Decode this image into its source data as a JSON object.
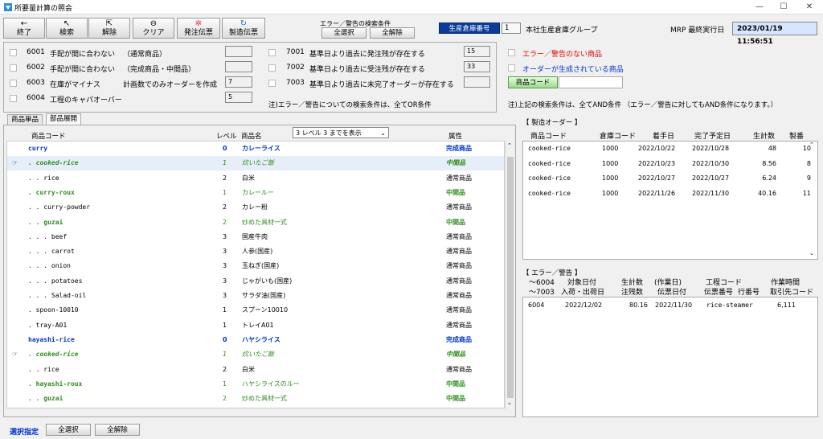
{
  "window": {
    "title": "所要量計算の照会",
    "minimize": "—",
    "maximize": "☐",
    "close": "✕"
  },
  "toolbar": {
    "buttons": [
      {
        "label": "終了",
        "icon": "←"
      },
      {
        "label": "検索",
        "icon": "↖"
      },
      {
        "label": "解除",
        "icon": "⇱"
      },
      {
        "label": "クリア",
        "icon": "⊖"
      },
      {
        "label": "発注伝票",
        "icon": "✲"
      },
      {
        "label": "製造伝票",
        "icon": "↻"
      }
    ]
  },
  "error_filter": {
    "title": "エラー／警告の検索条件",
    "select_all": "全選択",
    "deselect_all": "全解除"
  },
  "warehouse": {
    "label": "生産倉庫番号",
    "number": "1",
    "name": "本社生産倉庫グループ"
  },
  "mrp": {
    "label": "MRP 最終実行日",
    "datetime": "2023/01/19 11:56:51"
  },
  "conditions_left": [
    {
      "code": "6001",
      "text": "手配が間に合わない",
      "note": "（通常商品）",
      "value": ""
    },
    {
      "code": "6002",
      "text": "手配が間に合わない",
      "note": "（完成商品・中間品）",
      "value": ""
    },
    {
      "code": "6003",
      "text": "在庫がマイナス",
      "note": "計画数でのみオーダーを作成",
      "value": "7"
    },
    {
      "code": "6004",
      "text": "工程のキャパオーバー",
      "note": "",
      "value": "5"
    }
  ],
  "conditions_mid": [
    {
      "code": "7001",
      "text": "基準日より過去に発注残が存在する",
      "value": "15"
    },
    {
      "code": "7002",
      "text": "基準日より過去に受注残が存在する",
      "value": "33"
    },
    {
      "code": "7003",
      "text": "基準日より過去に未完了オーダーが存在する",
      "value": ""
    }
  ],
  "conditions_note": "注)エラー／警告についての検索条件は、全てOR条件",
  "conditions_right": {
    "no_error": "エラー／警告のない商品",
    "order_generated": "オーダーが生成されている商品",
    "product_code_label": "商品コード",
    "product_code_value": ""
  },
  "right_note": "注)上記の検索条件は、全てAND条件 （エラー／警告に対してもAND条件になります。）",
  "tabs": [
    {
      "label": "商品単品"
    },
    {
      "label": "部品展開"
    }
  ],
  "tree": {
    "headers": {
      "code": "商品コード",
      "level": "レベル",
      "name": "商品名",
      "attr": "属性"
    },
    "level_select": "3 レベル 3 までを表示",
    "rows": [
      {
        "code": "curry",
        "level": "0",
        "name": "カレーライス",
        "attr": "完成商品",
        "style": "blue",
        "indent": 0,
        "mark": ""
      },
      {
        "code": ". cooked-rice",
        "level": "1",
        "name": "炊いたご飯",
        "attr": "中間品",
        "style": "greenital",
        "indent": 1,
        "mark": "☞"
      },
      {
        "code": ". . rice",
        "level": "2",
        "name": "白米",
        "attr": "通常商品",
        "style": "plain",
        "indent": 2,
        "mark": ""
      },
      {
        "code": ". curry-roux",
        "level": "1",
        "name": "カレールー",
        "attr": "中間品",
        "style": "green",
        "indent": 1,
        "mark": ""
      },
      {
        "code": ". . curry-powder",
        "level": "2",
        "name": "カレー粉",
        "attr": "通常商品",
        "style": "plain",
        "indent": 2,
        "mark": ""
      },
      {
        "code": ". . guzai",
        "level": "2",
        "name": "炒めた具材一式",
        "attr": "中間品",
        "style": "green",
        "indent": 2,
        "mark": ""
      },
      {
        "code": ". . . beef",
        "level": "3",
        "name": "国産牛肉",
        "attr": "通常商品",
        "style": "plain",
        "indent": 3,
        "mark": ""
      },
      {
        "code": ". . . carrot",
        "level": "3",
        "name": "人参(国産)",
        "attr": "通常商品",
        "style": "plain",
        "indent": 3,
        "mark": ""
      },
      {
        "code": ". . . onion",
        "level": "3",
        "name": "玉ねぎ(国産)",
        "attr": "通常商品",
        "style": "plain",
        "indent": 3,
        "mark": ""
      },
      {
        "code": ". . . potatoes",
        "level": "3",
        "name": "じゃがいも(国産)",
        "attr": "通常商品",
        "style": "plain",
        "indent": 3,
        "mark": ""
      },
      {
        "code": ". . . Salad-oil",
        "level": "3",
        "name": "サラダ油(国産)",
        "attr": "通常商品",
        "style": "plain",
        "indent": 3,
        "mark": ""
      },
      {
        "code": ". spoon-10010",
        "level": "1",
        "name": "スプーン10010",
        "attr": "通常商品",
        "style": "plain",
        "indent": 1,
        "mark": ""
      },
      {
        "code": ". tray-A01",
        "level": "1",
        "name": "トレイA01",
        "attr": "通常商品",
        "style": "plain",
        "indent": 1,
        "mark": ""
      },
      {
        "code": "hayashi-rice",
        "level": "0",
        "name": "ハヤシライス",
        "attr": "完成商品",
        "style": "blue",
        "indent": 0,
        "mark": ""
      },
      {
        "code": ". cooked-rice",
        "level": "1",
        "name": "炊いたご飯",
        "attr": "中間品",
        "style": "greenital",
        "indent": 1,
        "mark": "☞"
      },
      {
        "code": ". . rice",
        "level": "2",
        "name": "白米",
        "attr": "通常商品",
        "style": "plain",
        "indent": 2,
        "mark": ""
      },
      {
        "code": ". hayashi-roux",
        "level": "1",
        "name": "ハヤシライスのルー",
        "attr": "中間品",
        "style": "green",
        "indent": 1,
        "mark": ""
      },
      {
        "code": ". . guzai",
        "level": "2",
        "name": "炒めた具材一式",
        "attr": "中間品",
        "style": "green",
        "indent": 2,
        "mark": ""
      }
    ]
  },
  "mfg_orders": {
    "title": "【 製造オーダー 】",
    "headers": [
      "商品コード",
      "倉庫コード",
      "着手日",
      "完了予定日",
      "生計数",
      "製番"
    ],
    "rows": [
      [
        "cooked-rice",
        "1000",
        "2022/10/22",
        "2022/10/28",
        "48",
        "10"
      ],
      [
        "cooked-rice",
        "1000",
        "2022/10/23",
        "2022/10/30",
        "8.56",
        "8"
      ],
      [
        "cooked-rice",
        "1000",
        "2022/10/27",
        "2022/10/27",
        "6.24",
        "9"
      ],
      [
        "cooked-rice",
        "1000",
        "2022/11/26",
        "2022/11/30",
        "40.16",
        "11"
      ]
    ]
  },
  "errors": {
    "title": "【 エラー／警告 】",
    "h1": [
      "～6004",
      "対象日付",
      "生計数",
      "(作業日)",
      "工程コード",
      "作業時間"
    ],
    "h2": [
      "～7003",
      "入荷・出荷日",
      "注残数",
      "伝票日付",
      "伝票番号",
      "行番号",
      "取引先コード"
    ],
    "rows": [
      [
        "6004",
        "2022/12/02",
        "80.16",
        "2022/11/30",
        "rice-steamer",
        "6,111"
      ]
    ]
  },
  "footer": {
    "label": "選択指定",
    "select_all": "全選択",
    "deselect_all": "全解除"
  },
  "colors": {
    "accent_blue": "#0033cc",
    "green": "#2e8b1e",
    "red": "#e00000",
    "warehouse_bg": "#0a3a9a",
    "mrp_bg": "#d6e6ff"
  }
}
